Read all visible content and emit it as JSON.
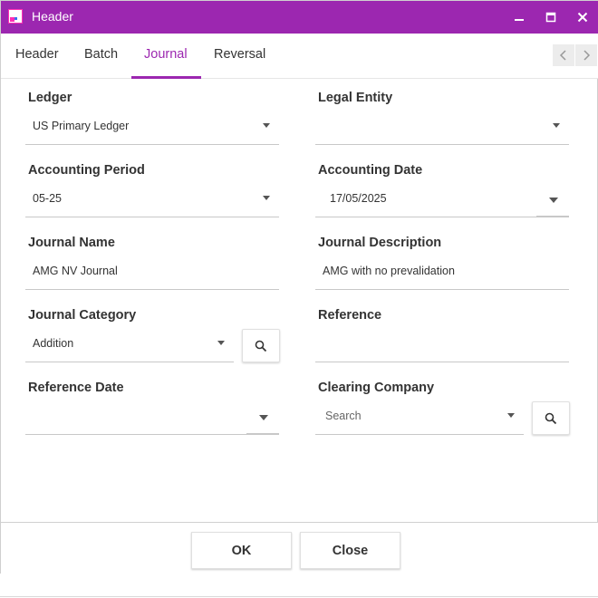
{
  "window": {
    "title": "Header"
  },
  "tabs": [
    {
      "label": "Header"
    },
    {
      "label": "Batch"
    },
    {
      "label": "Journal",
      "active": true
    },
    {
      "label": "Reversal"
    }
  ],
  "fields": {
    "ledger": {
      "label": "Ledger",
      "value": "US Primary Ledger"
    },
    "legal_entity": {
      "label": "Legal Entity",
      "value": ""
    },
    "accounting_period": {
      "label": "Accounting Period",
      "value": "05-25"
    },
    "accounting_date": {
      "label": "Accounting Date",
      "value": "17/05/2025"
    },
    "journal_name": {
      "label": "Journal Name",
      "value": "AMG NV Journal"
    },
    "journal_description": {
      "label": "Journal Description",
      "value": "AMG with no prevalidation"
    },
    "journal_category": {
      "label": "Journal Category",
      "value": "Addition"
    },
    "reference": {
      "label": "Reference",
      "value": ""
    },
    "reference_date": {
      "label": "Reference Date",
      "value": ""
    },
    "clearing_company": {
      "label": "Clearing Company",
      "placeholder": "Search"
    }
  },
  "footer": {
    "ok_label": "OK",
    "close_label": "Close"
  },
  "colors": {
    "accent": "#9c27b0",
    "title_text": "#ffffff"
  },
  "icons": [
    "app-icon",
    "minimize-icon",
    "maximize-icon",
    "close-icon",
    "chevron-left-icon",
    "chevron-right-icon",
    "search-icon",
    "dropdown-arrow-icon"
  ]
}
